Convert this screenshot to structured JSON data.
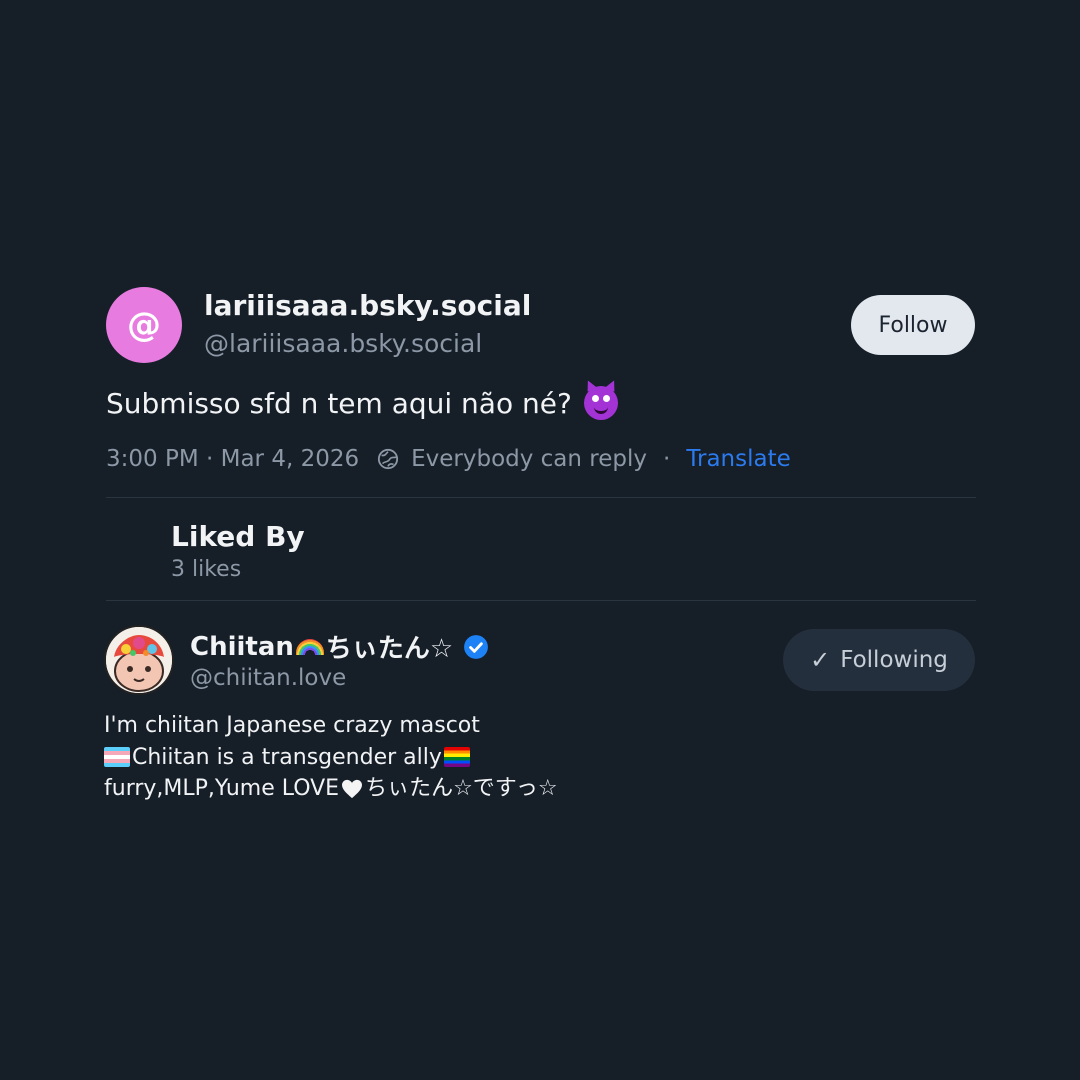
{
  "post": {
    "author": {
      "avatar_glyph": "@",
      "avatar_color": "#e77be0",
      "display_name": "lariiisaaa.bsky.social",
      "handle": "@lariiisaaa.bsky.social",
      "follow_label": "Follow"
    },
    "text": "Submisso sfd n tem aqui não né?",
    "emoji": "smiling-devil-icon",
    "timestamp": "3:00 PM · Mar 4, 2026",
    "reply_setting": "Everybody can reply",
    "separator": "·",
    "translate_label": "Translate",
    "accent_color": "#2b7bef"
  },
  "liked_by": {
    "title": "Liked By",
    "count": "3 likes"
  },
  "liker": {
    "name": "Chiitan",
    "name_suffix": "ちぃたん☆",
    "handle": "@chiitan.love",
    "following_label": "Following",
    "verified": true,
    "bio_line1": "I'm chiitan Japanese crazy mascot",
    "bio_line2": "Chiitan is a transgender ally",
    "bio_line3_a": "furry,MLP,Yume LOVE",
    "bio_line3_b": "ちぃたん☆ですっ☆"
  }
}
